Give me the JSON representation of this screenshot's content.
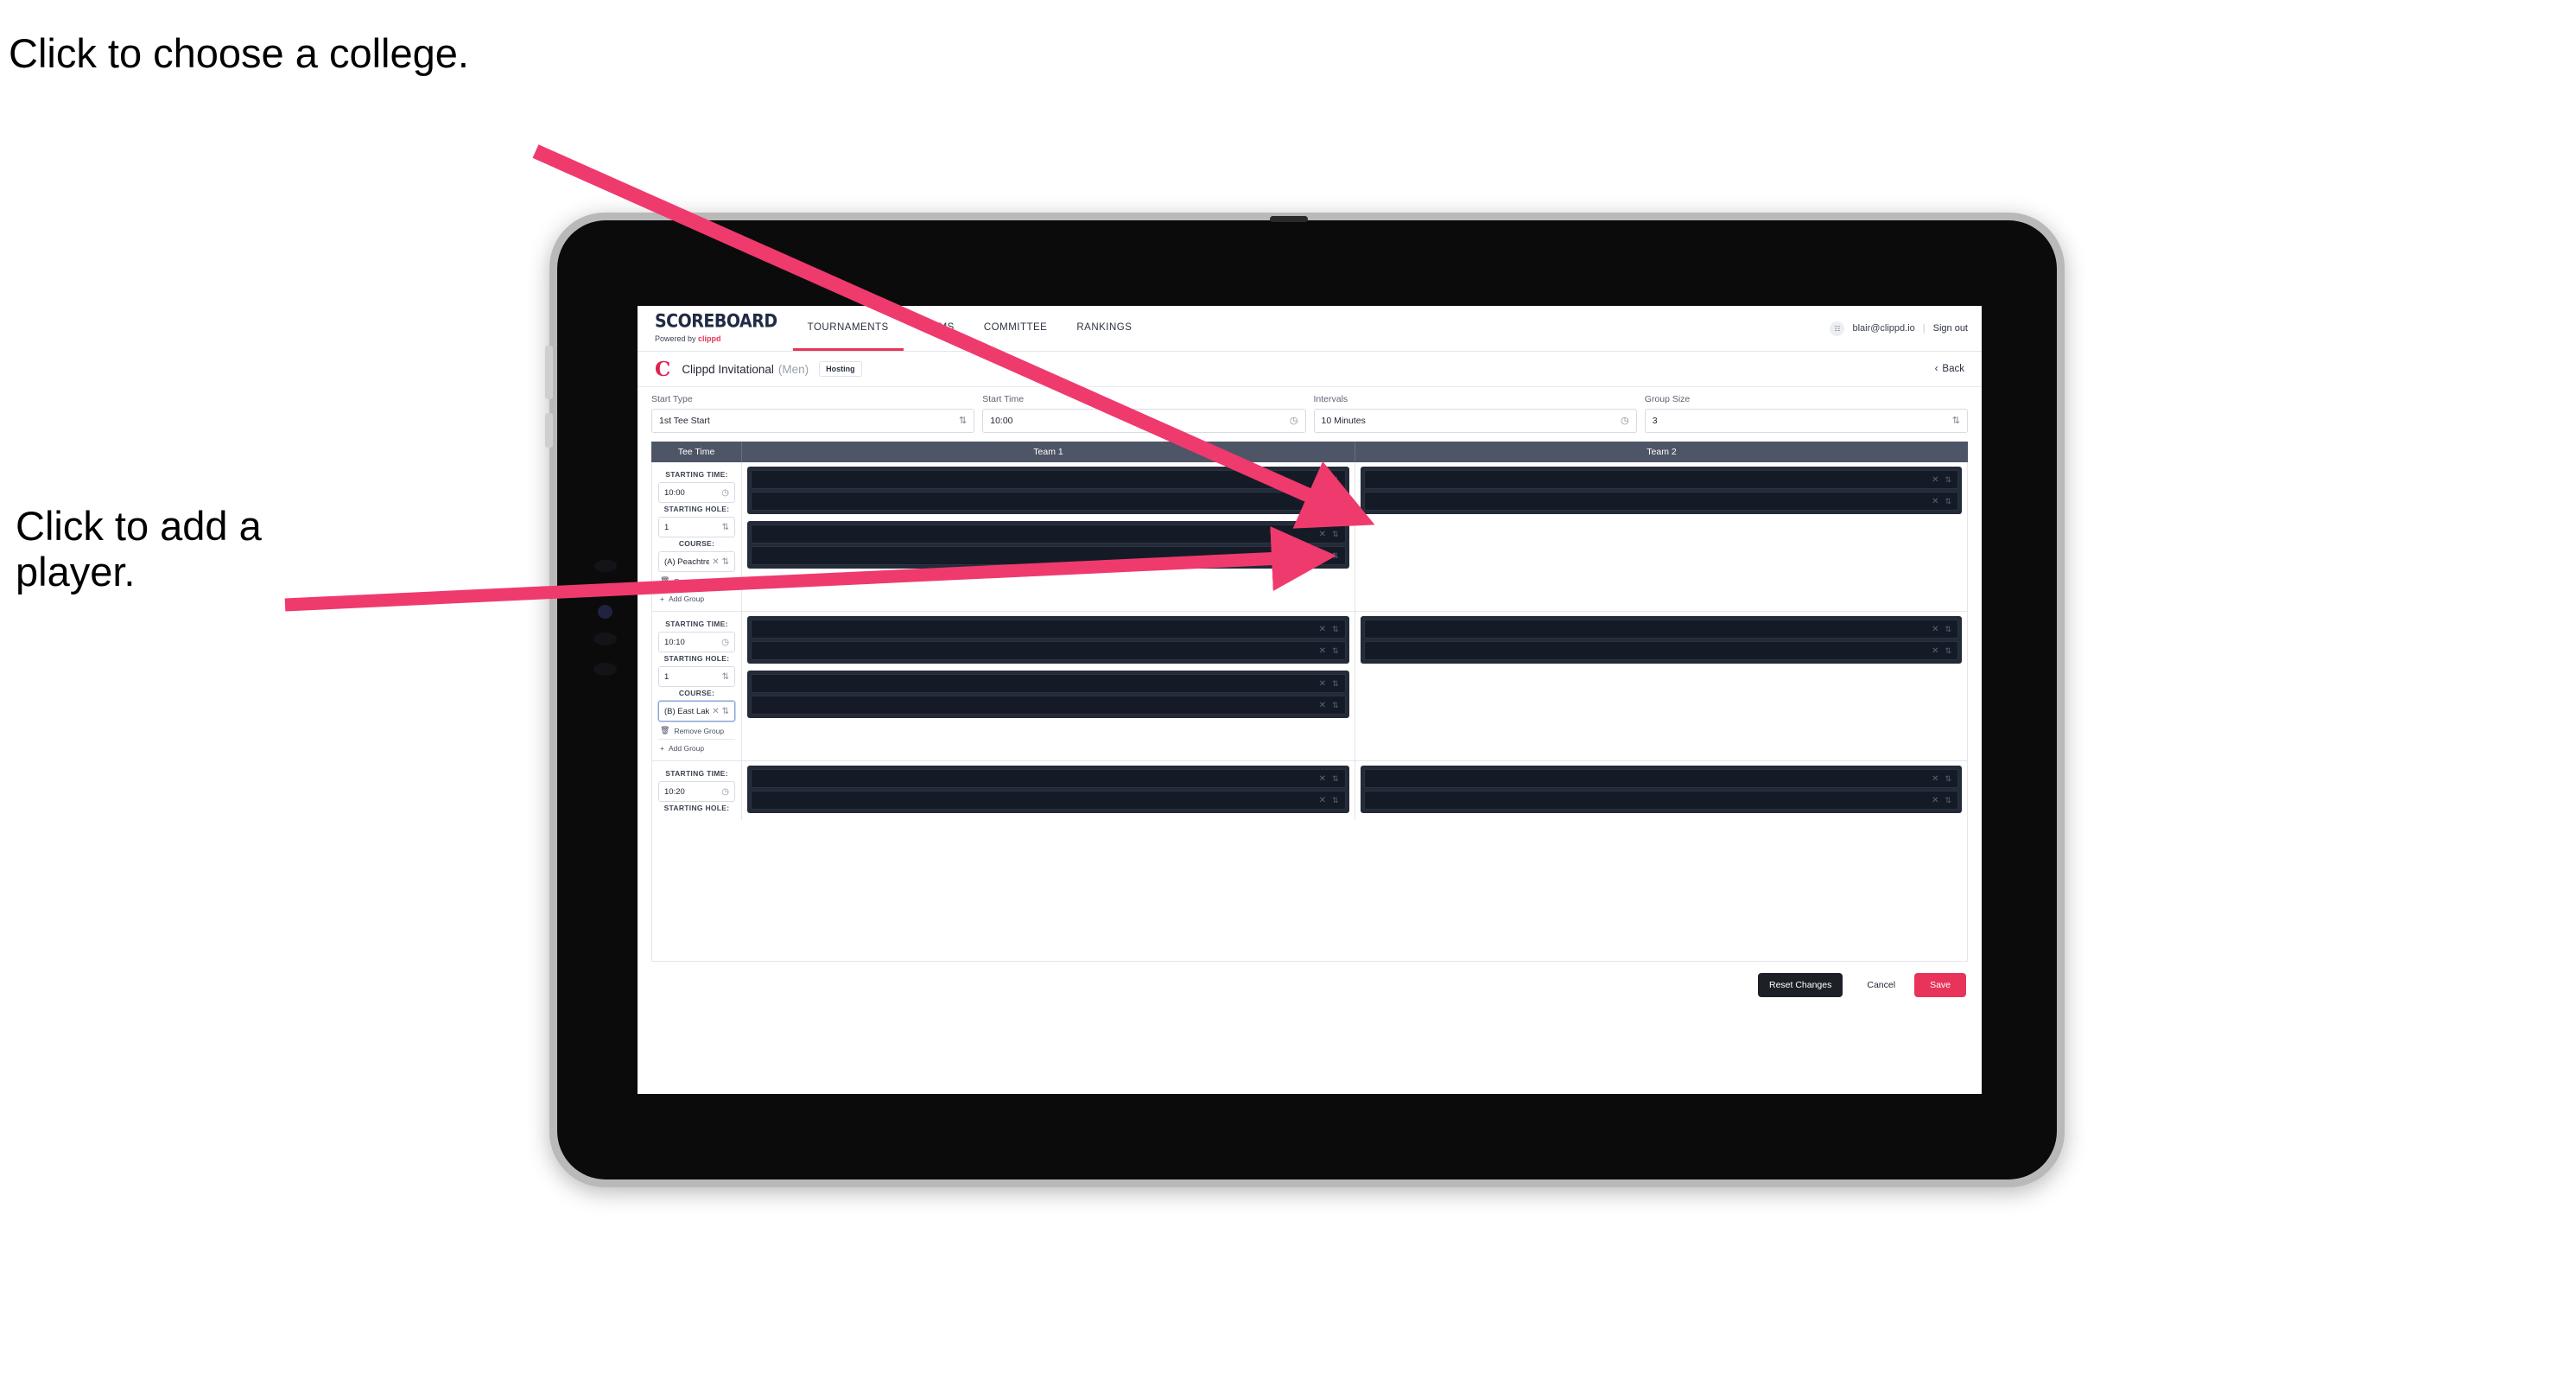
{
  "annotations": [
    {
      "id": "choose-college",
      "text": "Click to choose a college."
    },
    {
      "id": "add-player",
      "text": "Click to add a player."
    }
  ],
  "colors": {
    "accent": "#e8345a",
    "arrow": "#ef3a6e",
    "table_header_bg": "#4e5566",
    "redacted": "#232a38",
    "dark_button": "#1d2127"
  },
  "navbar": {
    "brand": {
      "word": "SCOREBOARD",
      "powered_prefix": "Powered by ",
      "powered_brand": "clippd"
    },
    "links": [
      {
        "label": "TOURNAMENTS",
        "active": true
      },
      {
        "label": "TEAMS",
        "active": false
      },
      {
        "label": "COMMITTEE",
        "active": false
      },
      {
        "label": "RANKINGS",
        "active": false
      }
    ],
    "account": {
      "avatar_glyph": "☷",
      "email": "blair@clippd.io",
      "separator": "|",
      "sign_out": "Sign out"
    }
  },
  "tournament_bar": {
    "logo_letter": "C",
    "name": "Clippd Invitational",
    "gender": "(Men)",
    "badge": "Hosting",
    "back": {
      "chevron": "‹",
      "label": "Back"
    }
  },
  "controls": [
    {
      "name": "start-type",
      "label": "Start Type",
      "value": "1st Tee Start",
      "icon": "⇅",
      "icon_name": "stepper-icon"
    },
    {
      "name": "start-time",
      "label": "Start Time",
      "value": "10:00",
      "icon": "◷",
      "icon_name": "clock-icon"
    },
    {
      "name": "intervals",
      "label": "Intervals",
      "value": "10 Minutes",
      "icon": "◷",
      "icon_name": "clock-icon"
    },
    {
      "name": "group-size",
      "label": "Group Size",
      "value": "3",
      "icon": "⇅",
      "icon_name": "stepper-icon"
    }
  ],
  "table": {
    "headers": [
      "Tee Time",
      "Team 1",
      "Team 2"
    ],
    "field_labels": {
      "time": "STARTING TIME:",
      "hole": "STARTING HOLE:",
      "course": "COURSE:"
    },
    "group_actions": {
      "remove": "Remove Group",
      "remove_icon": "Ὕ1",
      "add": "Add Group",
      "add_icon": "+"
    },
    "row_icons": {
      "remove": "✕",
      "stepper": "⇅"
    },
    "rows": [
      {
        "tee": {
          "time": "10:00",
          "hole": "1",
          "course": "(A) Peachtree GC",
          "course_focused": false,
          "show_actions": true
        },
        "team1": [
          {
            "players": [
              "",
              ""
            ]
          },
          {
            "players": [
              "",
              ""
            ]
          }
        ],
        "team2": [
          {
            "players": [
              "",
              ""
            ]
          }
        ]
      },
      {
        "tee": {
          "time": "10:10",
          "hole": "1",
          "course": "(B) East Lake GC",
          "course_focused": true,
          "show_actions": true
        },
        "team1": [
          {
            "players": [
              "",
              ""
            ]
          },
          {
            "players": [
              "",
              ""
            ]
          }
        ],
        "team2": [
          {
            "players": [
              "",
              ""
            ]
          }
        ]
      },
      {
        "tee": {
          "time": "10:20",
          "hole": "",
          "course": "",
          "course_focused": false,
          "show_actions": false
        },
        "team1": [
          {
            "players": [
              "",
              ""
            ]
          }
        ],
        "team2": [
          {
            "players": [
              "",
              ""
            ]
          }
        ]
      }
    ]
  },
  "footer": {
    "reset": "Reset Changes",
    "cancel": "Cancel",
    "save": "Save"
  }
}
